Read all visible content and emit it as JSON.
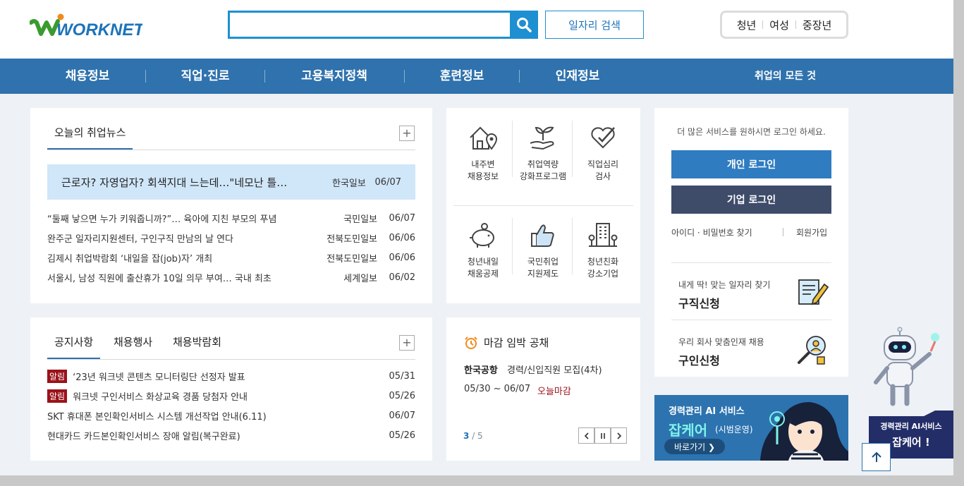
{
  "header": {
    "logo_text": "WORKNET",
    "search_placeholder": "",
    "job_search_label": "일자리 검색",
    "user_tabs": [
      "청년",
      "여성",
      "중장년"
    ]
  },
  "nav": {
    "items": [
      "채용정보",
      "직업·진로",
      "고용복지정책",
      "훈련정보",
      "인재정보"
    ],
    "all_label": "취업의 모든 것"
  },
  "news": {
    "title": "오늘의 취업뉴스",
    "headline": {
      "title": "근로자? 자영업자? 회색지대 느는데…\"네모난 틀…",
      "source": "한국일보",
      "date": "06/07"
    },
    "items": [
      {
        "title": "“둘째 낳으면 누가 키워줍니까?”… 육아에 지친 부모의 푸념",
        "source": "국민일보",
        "date": "06/07"
      },
      {
        "title": "완주군 일자리지원센터, 구인구직 만남의 날 연다",
        "source": "전북도민일보",
        "date": "06/06"
      },
      {
        "title": "김제시 취업박람회 ‘내일을 잡(job)자’ 개최",
        "source": "전북도민일보",
        "date": "06/06"
      },
      {
        "title": "서울시, 남성 직원에 출산휴가 10일 의무 부여… 국내 최초",
        "source": "세계일보",
        "date": "06/02"
      }
    ]
  },
  "notice": {
    "tabs": [
      "공지사항",
      "채용행사",
      "채용박람회"
    ],
    "items": [
      {
        "badge": "알림",
        "title": "‘23년 워크넷 콘텐츠 모니터링단 선정자 발표",
        "date": "05/31"
      },
      {
        "badge": "알림",
        "title": "워크넷 구인서비스 화상교육 경품 당첨자 안내",
        "date": "05/26"
      },
      {
        "badge": "",
        "title": "SKT 휴대폰 본인확인서비스 시스템 개선작업 안내(6.11)",
        "date": "06/07"
      },
      {
        "badge": "",
        "title": "현대카드 카드본인확인서비스 장애 알림(복구완료)",
        "date": "05/26"
      }
    ]
  },
  "services": [
    {
      "label": "내주변\n채용정보",
      "icon": "house-map-pin-icon"
    },
    {
      "label": "취업역량\n강화프로그램",
      "icon": "hand-sprout-icon"
    },
    {
      "label": "직업심리\n검사",
      "icon": "heart-pencil-icon"
    },
    {
      "label": "청년내일\n채움공제",
      "icon": "piggy-bank-icon"
    },
    {
      "label": "국민취업\n지원제도",
      "icon": "thumbs-up-icon"
    },
    {
      "label": "청년친화\n강소기업",
      "icon": "building-icon"
    }
  ],
  "deadline": {
    "title": "마감 임박 공채",
    "company": "한국공항",
    "job": "경력/신입직원 모집(4차)",
    "period": "05/30 ~ 06/07",
    "status": "오늘마감",
    "page_current": "3",
    "page_total": "/ 5"
  },
  "login": {
    "message": "더 많은 서비스를 원하시면 로그인 하세요.",
    "personal_label": "개인 로그인",
    "company_label": "기업 로그인",
    "find_label": "아이디 · 비밀번호 찾기",
    "join_label": "회원가입",
    "job_seek_sub": "내게 딱! 맞는 일자리 찾기",
    "job_seek_main": "구직신청",
    "recruit_sub": "우리 회사 맞춤인재 채용",
    "recruit_main": "구인신청"
  },
  "banner": {
    "line1": "경력관리 AI 서비스",
    "line2": "잡케어",
    "line3": "(시범운영)",
    "button": "바로가기 ❯"
  },
  "robot": {
    "line1": "경력관리 AI서비스",
    "line2": "잡케어 !"
  },
  "colors": {
    "primary": "#2f72ad",
    "search_blue": "#1e8fd1",
    "headline_bg": "#d0e6f9",
    "badge_red": "#9b1219",
    "company_btn": "#3e4c6a",
    "personal_btn": "#2f7cc0"
  }
}
